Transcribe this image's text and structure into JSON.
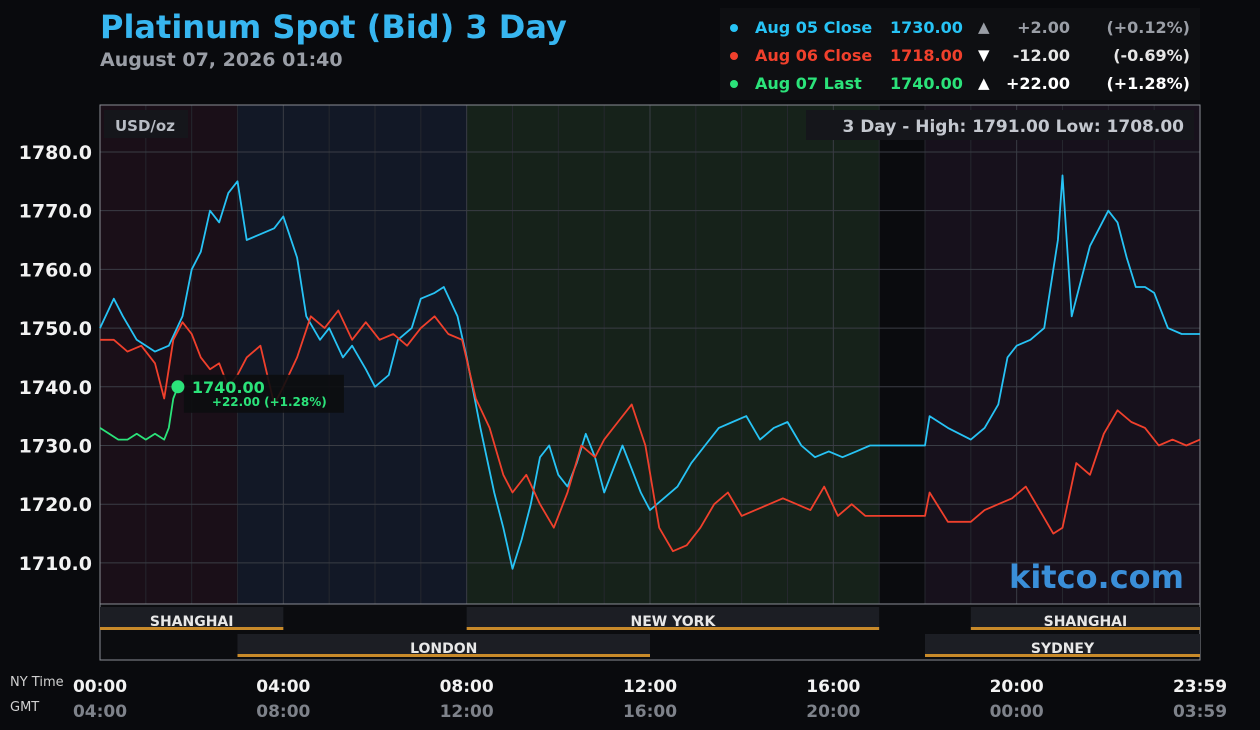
{
  "header": {
    "title": "Platinum Spot (Bid) 3 Day",
    "subtitle": "August 07, 2026 01:40"
  },
  "legend": [
    {
      "name": "Aug 05 Close",
      "value": "1730.00",
      "arrow": "▲",
      "change": "+2.00",
      "pct": "(+0.12%)",
      "color": "#27c3f5",
      "text_color": "#27c3f5",
      "change_color": "#9a9ea6"
    },
    {
      "name": "Aug 06 Close",
      "value": "1718.00",
      "arrow": "▼",
      "change": "-12.00",
      "pct": "(-0.69%)",
      "color": "#f0402c",
      "text_color": "#f0402c",
      "change_color": "#e6e6e6"
    },
    {
      "name": "Aug 07 Last",
      "value": "1740.00",
      "arrow": "▲",
      "change": "+22.00",
      "pct": "(+1.28%)",
      "color": "#2be37a",
      "text_color": "#2be37a",
      "change_color": "#ffffff"
    }
  ],
  "labels": {
    "unit": "USD/oz",
    "range": "3 Day - High: 1791.00  Low: 1708.00",
    "watermark": "kitco.com",
    "ny_time": "NY Time",
    "gmt": "GMT",
    "last_marker_value": "1740.00",
    "last_marker_change": "+22.00 (+1.28%)"
  },
  "chart_data": {
    "type": "line",
    "ylim": [
      1703,
      1788
    ],
    "y_ticks": [
      "1710.0",
      "1720.0",
      "1730.0",
      "1740.0",
      "1750.0",
      "1760.0",
      "1770.0",
      "1780.0"
    ],
    "x_ticks": [
      {
        "ny": "00:00",
        "gmt": "04:00",
        "hour": 0
      },
      {
        "ny": "04:00",
        "gmt": "08:00",
        "hour": 4
      },
      {
        "ny": "08:00",
        "gmt": "12:00",
        "hour": 8
      },
      {
        "ny": "12:00",
        "gmt": "16:00",
        "hour": 12
      },
      {
        "ny": "16:00",
        "gmt": "20:00",
        "hour": 16
      },
      {
        "ny": "20:00",
        "gmt": "00:00",
        "hour": 20
      },
      {
        "ny": "23:59",
        "gmt": "03:59",
        "hour": 24
      }
    ],
    "sessions": [
      {
        "name": "SHANGHAI",
        "start": 0,
        "end": 4,
        "row": 1
      },
      {
        "name": "NEW YORK",
        "start": 8,
        "end": 17,
        "row": 1
      },
      {
        "name": "SHANGHAI",
        "start": 19,
        "end": 24,
        "row": 1
      },
      {
        "name": "LONDON",
        "start": 3,
        "end": 12,
        "row": 2
      },
      {
        "name": "SYDNEY",
        "start": 18,
        "end": 24,
        "row": 2
      }
    ],
    "series": [
      {
        "name": "Aug 05 Close",
        "color": "#27c3f5",
        "x": [
          0,
          0.3,
          0.5,
          0.8,
          1.2,
          1.5,
          1.8,
          2.0,
          2.2,
          2.4,
          2.6,
          2.8,
          3.0,
          3.2,
          3.5,
          3.8,
          4.0,
          4.3,
          4.5,
          4.8,
          5.0,
          5.3,
          5.5,
          5.8,
          6.0,
          6.3,
          6.5,
          6.8,
          7.0,
          7.3,
          7.5,
          7.8,
          8.0,
          8.3,
          8.6,
          8.8,
          9.0,
          9.2,
          9.4,
          9.6,
          9.8,
          10.0,
          10.2,
          10.4,
          10.6,
          10.8,
          11.0,
          11.2,
          11.4,
          11.6,
          11.8,
          12.0,
          12.3,
          12.6,
          12.9,
          13.2,
          13.5,
          13.8,
          14.1,
          14.4,
          14.7,
          15.0,
          15.3,
          15.6,
          15.9,
          16.2,
          16.5,
          16.8,
          17.0,
          17.5,
          18.0,
          18.1,
          18.5,
          19.0,
          19.3,
          19.6,
          19.8,
          20.0,
          20.3,
          20.6,
          20.9,
          21.0,
          21.2,
          21.4,
          21.6,
          21.8,
          22.0,
          22.2,
          22.4,
          22.6,
          22.8,
          23.0,
          23.3,
          23.6,
          23.8,
          24.0
        ],
        "y": [
          1750,
          1755,
          1752,
          1748,
          1746,
          1747,
          1752,
          1760,
          1763,
          1770,
          1768,
          1773,
          1775,
          1765,
          1766,
          1767,
          1769,
          1762,
          1752,
          1748,
          1750,
          1745,
          1747,
          1743,
          1740,
          1742,
          1748,
          1750,
          1755,
          1756,
          1757,
          1752,
          1745,
          1733,
          1722,
          1716,
          1709,
          1714,
          1720,
          1728,
          1730,
          1725,
          1723,
          1727,
          1732,
          1728,
          1722,
          1726,
          1730,
          1726,
          1722,
          1719,
          1721,
          1723,
          1727,
          1730,
          1733,
          1734,
          1735,
          1731,
          1733,
          1734,
          1730,
          1728,
          1729,
          1728,
          1729,
          1730,
          1730,
          1730,
          1730,
          1735,
          1733,
          1731,
          1733,
          1737,
          1745,
          1747,
          1748,
          1750,
          1765,
          1776,
          1752,
          1758,
          1764,
          1767,
          1770,
          1768,
          1762,
          1757,
          1757,
          1756,
          1750,
          1749,
          1749,
          1749
        ]
      },
      {
        "name": "Aug 06 Close",
        "color": "#f0402c",
        "x": [
          0,
          0.3,
          0.6,
          0.9,
          1.2,
          1.4,
          1.6,
          1.8,
          2.0,
          2.2,
          2.4,
          2.6,
          2.8,
          3.0,
          3.2,
          3.5,
          3.8,
          4.0,
          4.3,
          4.6,
          4.9,
          5.2,
          5.5,
          5.8,
          6.1,
          6.4,
          6.7,
          7.0,
          7.3,
          7.6,
          7.9,
          8.2,
          8.5,
          8.8,
          9.0,
          9.3,
          9.6,
          9.9,
          10.2,
          10.5,
          10.8,
          11.0,
          11.3,
          11.6,
          11.9,
          12.2,
          12.5,
          12.8,
          13.1,
          13.4,
          13.7,
          14.0,
          14.3,
          14.6,
          14.9,
          15.2,
          15.5,
          15.8,
          16.1,
          16.4,
          16.7,
          17.0,
          17.5,
          18.0,
          18.1,
          18.5,
          19.0,
          19.3,
          19.6,
          19.9,
          20.2,
          20.5,
          20.8,
          21.0,
          21.3,
          21.6,
          21.9,
          22.2,
          22.5,
          22.8,
          23.1,
          23.4,
          23.7,
          24.0
        ],
        "y": [
          1748,
          1748,
          1746,
          1747,
          1744,
          1738,
          1748,
          1751,
          1749,
          1745,
          1743,
          1744,
          1740,
          1742,
          1745,
          1747,
          1737,
          1740,
          1745,
          1752,
          1750,
          1753,
          1748,
          1751,
          1748,
          1749,
          1747,
          1750,
          1752,
          1749,
          1748,
          1738,
          1733,
          1725,
          1722,
          1725,
          1720,
          1716,
          1722,
          1730,
          1728,
          1731,
          1734,
          1737,
          1730,
          1716,
          1712,
          1713,
          1716,
          1720,
          1722,
          1718,
          1719,
          1720,
          1721,
          1720,
          1719,
          1723,
          1718,
          1720,
          1718,
          1718,
          1718,
          1718,
          1722,
          1717,
          1717,
          1719,
          1720,
          1721,
          1723,
          1719,
          1715,
          1716,
          1727,
          1725,
          1732,
          1736,
          1734,
          1733,
          1730,
          1731,
          1730,
          1731
        ]
      },
      {
        "name": "Aug 07 Last",
        "color": "#2be37a",
        "x": [
          0,
          0.2,
          0.4,
          0.6,
          0.8,
          1.0,
          1.2,
          1.4,
          1.5,
          1.6,
          1.7
        ],
        "y": [
          1733,
          1732,
          1731,
          1731,
          1732,
          1731,
          1732,
          1731,
          1733,
          1738,
          1740
        ]
      }
    ]
  }
}
